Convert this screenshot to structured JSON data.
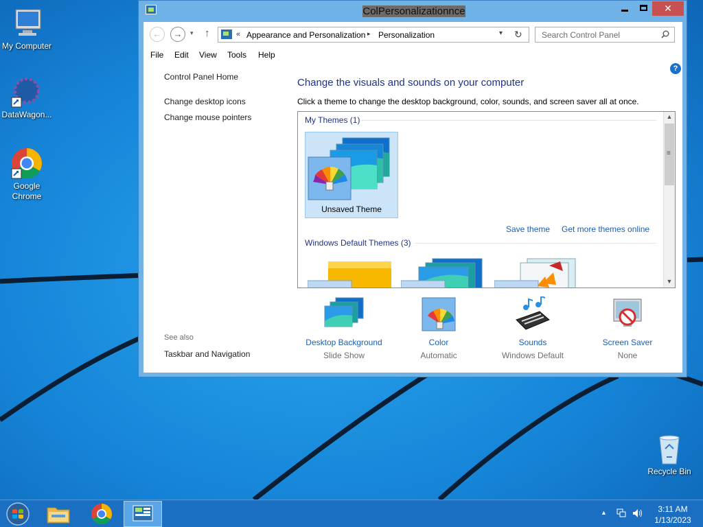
{
  "desktop": {
    "icons": [
      {
        "label": "My Computer",
        "icon": "computer-icon"
      },
      {
        "label": "DataWagon...",
        "icon": "datawagon-icon"
      },
      {
        "label": "Google Chrome",
        "icon": "chrome-icon"
      },
      {
        "label": "Recycle Bin",
        "icon": "recycle-bin-icon"
      }
    ],
    "colors": {
      "background": "#1383d4",
      "lines": "#0a1a2e"
    }
  },
  "window": {
    "title": "ColPersonalizationnce",
    "controls": {
      "minimize": "minimize",
      "maximize": "maximize",
      "close": "✕"
    },
    "nav": {
      "back": "←",
      "forward": "→",
      "recent": "▾",
      "up": "↑"
    },
    "address": {
      "chevron": "«",
      "crumbs": [
        "Appearance and Personalization",
        "Personalization"
      ],
      "separator": "▸",
      "dropdown": "▾",
      "refresh": "↻"
    },
    "search": {
      "placeholder": "Search Control Panel"
    },
    "menu": [
      "File",
      "Edit",
      "View",
      "Tools",
      "Help"
    ],
    "left_pane": {
      "home": "Control Panel Home",
      "links": [
        "Change desktop icons",
        "Change mouse pointers"
      ],
      "see_also_label": "See also",
      "see_also_links": [
        "Taskbar and Navigation"
      ]
    },
    "main": {
      "help": "?",
      "heading": "Change the visuals and sounds on your computer",
      "subtitle": "Click a theme to change the desktop background, color, sounds, and screen saver all at once.",
      "my_themes_header": "My Themes (1)",
      "unsaved_theme_label": "Unsaved Theme",
      "save_theme": "Save theme",
      "get_more_themes": "Get more themes online",
      "default_themes_header": "Windows Default Themes (3)",
      "scroll": {
        "up": "▲",
        "down": "▼"
      }
    },
    "customize": [
      {
        "label": "Desktop Background",
        "value": "Slide Show",
        "icon": "desktop-background-icon"
      },
      {
        "label": "Color",
        "value": "Automatic",
        "icon": "color-icon"
      },
      {
        "label": "Sounds",
        "value": "Windows Default",
        "icon": "sounds-icon"
      },
      {
        "label": "Screen Saver",
        "value": "None",
        "icon": "screen-saver-icon"
      }
    ]
  },
  "taskbar": {
    "pinned": [
      "file-explorer-icon",
      "chrome-icon",
      "control-panel-icon"
    ],
    "tray": {
      "arrow": "▲"
    },
    "time": "3:11 AM",
    "date": "1/13/2023",
    "colors": {
      "background": "#1a6fc2"
    }
  }
}
